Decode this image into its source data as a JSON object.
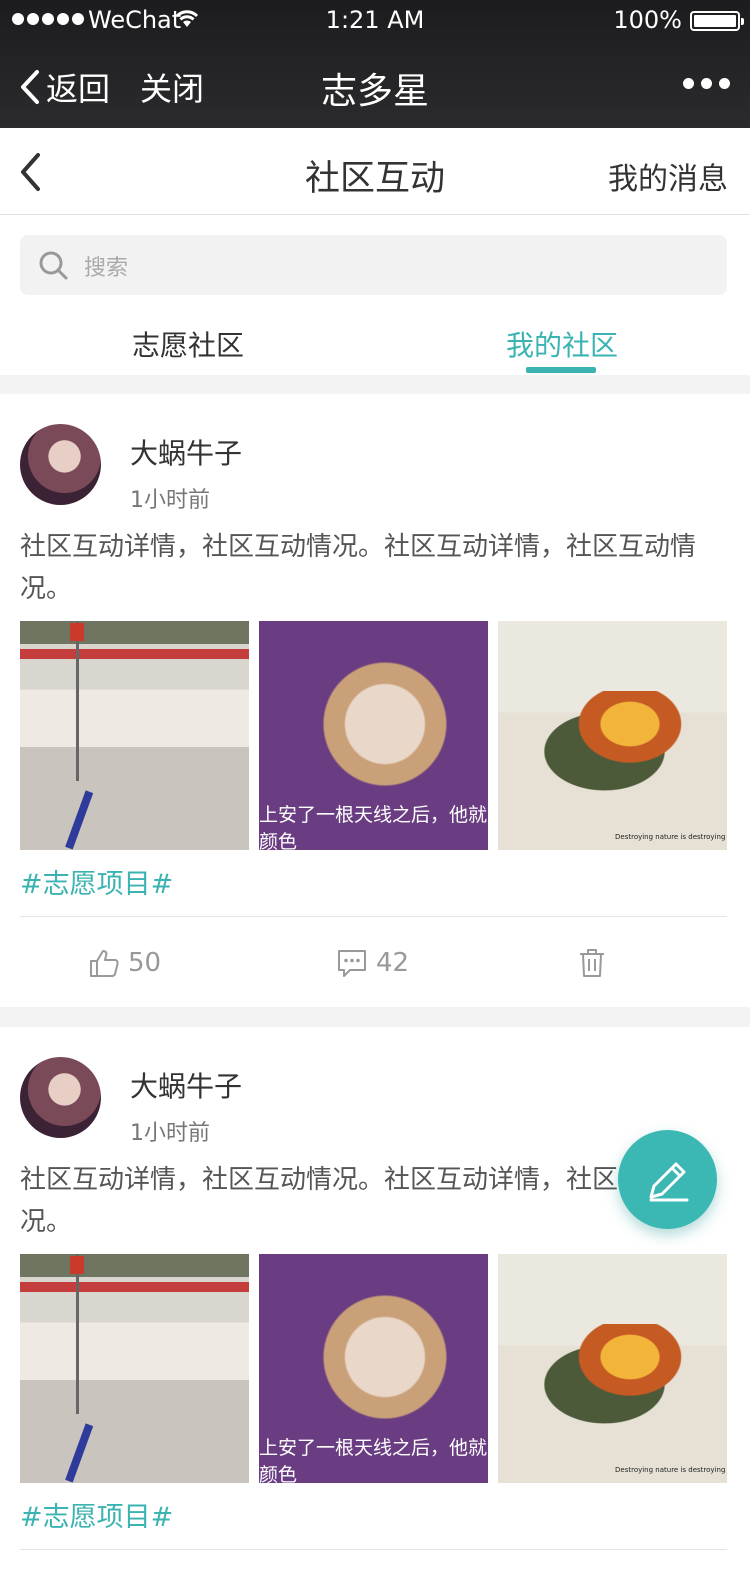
{
  "status_bar": {
    "carrier": "WeChat",
    "time": "1:21 AM",
    "battery": "100%"
  },
  "wechat_nav": {
    "back_label": "返回",
    "close_label": "关闭",
    "title": "志多星"
  },
  "header": {
    "title": "社区互动",
    "messages_label": "我的消息"
  },
  "search": {
    "placeholder": "搜索"
  },
  "tabs": [
    {
      "label": "志愿社区",
      "active": false
    },
    {
      "label": "我的社区",
      "active": true
    }
  ],
  "colors": {
    "accent": "#3bb3b0",
    "nav_bg": "#1c1c1e"
  },
  "posts": [
    {
      "username": "大蜗牛子",
      "time": "1小时前",
      "content": "社区互动详情，社区互动情况。社区互动详情，社区互动情况。",
      "image_caption": "上安了一根天线之后，他就",
      "image_caption_2": "颜色",
      "image_slogan": "Destroying nature is destroying life.",
      "tag": "#志愿项目#",
      "likes": "50",
      "comments": "42"
    },
    {
      "username": "大蜗牛子",
      "time": "1小时前",
      "content": "社区互动详情，社区互动情况。社区互动详情，社区互动情况。",
      "image_caption": "上安了一根天线之后，他就",
      "image_caption_2": "颜色",
      "image_slogan": "Destroying nature is destroying life.",
      "tag": "#志愿项目#"
    }
  ],
  "icons": [
    "back-chevron-icon",
    "more-dots-icon",
    "search-icon",
    "thumbs-up-icon",
    "comment-icon",
    "trash-icon",
    "pencil-icon"
  ]
}
